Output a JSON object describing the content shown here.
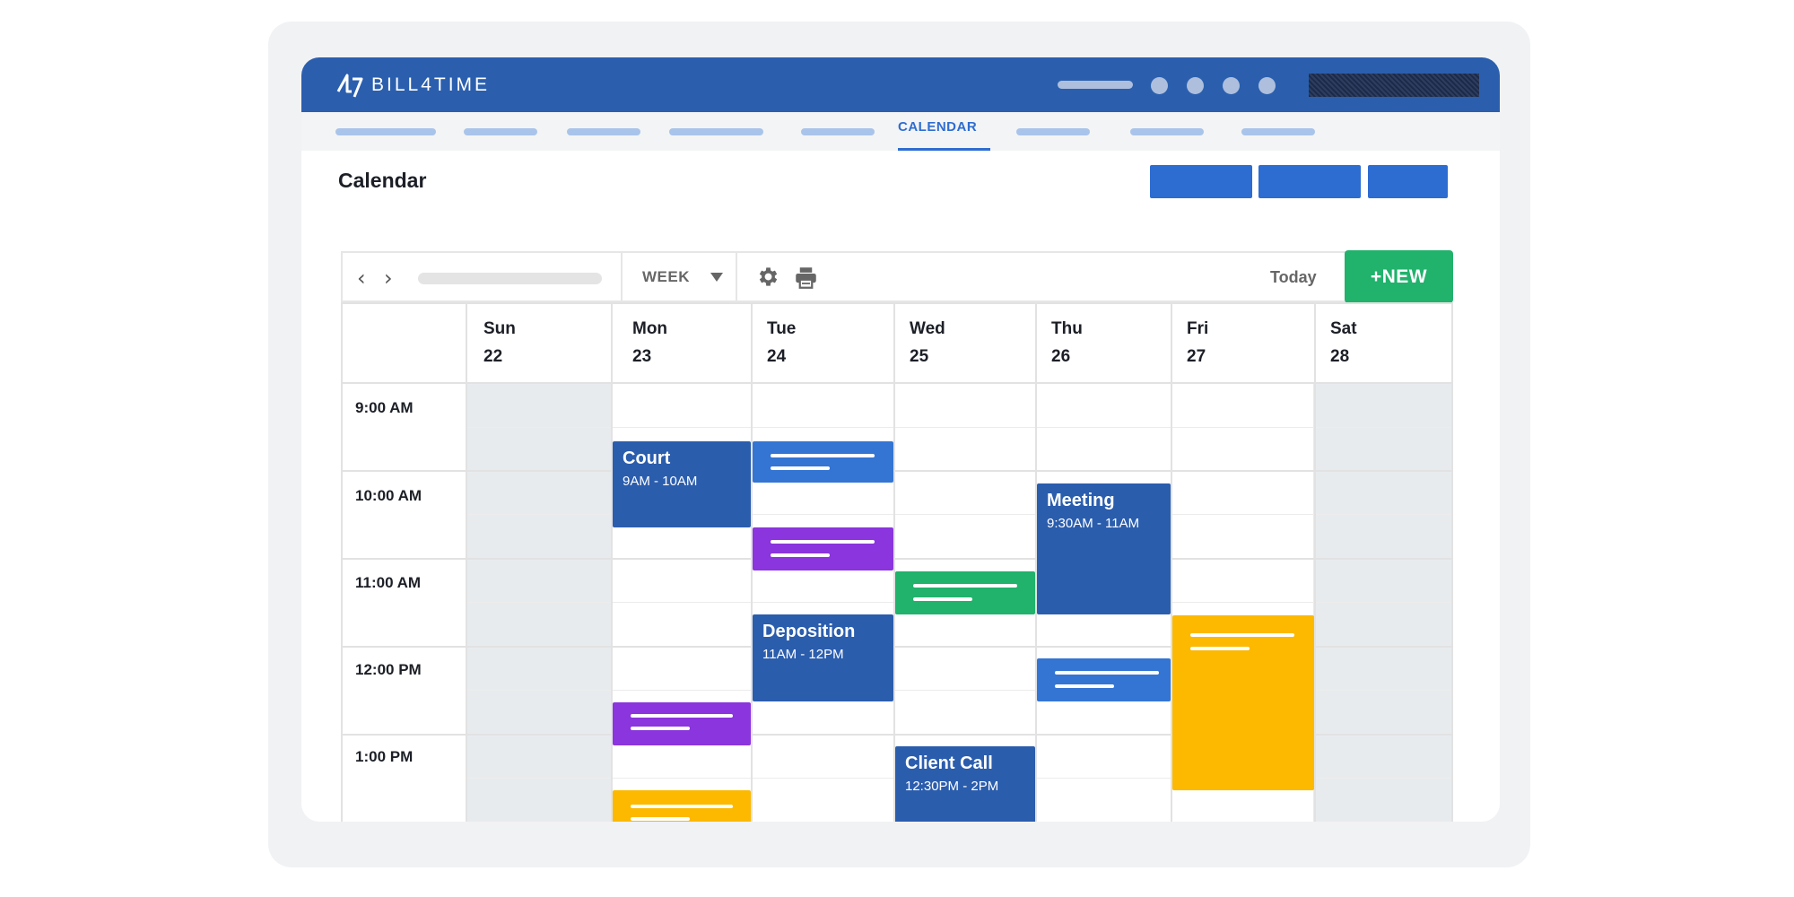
{
  "app": {
    "brand": "BILL4TIME"
  },
  "nav": {
    "active_tab": "CALENDAR"
  },
  "page": {
    "title": "Calendar"
  },
  "toolbar": {
    "prev_icon": "chevron-left-icon",
    "next_icon": "chevron-right-icon",
    "view_label": "WEEK",
    "settings_icon": "gear-icon",
    "print_icon": "printer-icon",
    "today_label": "Today",
    "new_label": "+NEW"
  },
  "days": [
    {
      "name": "Sun",
      "num": "22"
    },
    {
      "name": "Mon",
      "num": "23"
    },
    {
      "name": "Tue",
      "num": "24"
    },
    {
      "name": "Wed",
      "num": "25"
    },
    {
      "name": "Thu",
      "num": "26"
    },
    {
      "name": "Fri",
      "num": "27"
    },
    {
      "name": "Sat",
      "num": "28"
    }
  ],
  "times": [
    "9:00 AM",
    "10:00 AM",
    "11:00 AM",
    "12:00 PM",
    "1:00 PM"
  ],
  "events": {
    "court": {
      "title": "Court",
      "time": "9AM - 10AM"
    },
    "meeting": {
      "title": "Meeting",
      "time": "9:30AM - 11AM"
    },
    "deposition": {
      "title": "Deposition",
      "time": "11AM - 12PM"
    },
    "client_call": {
      "title": "Client Call",
      "time": "12:30PM - 2PM"
    }
  },
  "colors": {
    "topbar": "#2b5fae",
    "primary": "#2d6cd1",
    "new_button": "#21b26c",
    "event_dark_blue": "#2b5dad",
    "event_blue": "#3475d4",
    "event_purple": "#8a35dd",
    "event_green": "#21b26c",
    "event_yellow": "#fcb900"
  }
}
